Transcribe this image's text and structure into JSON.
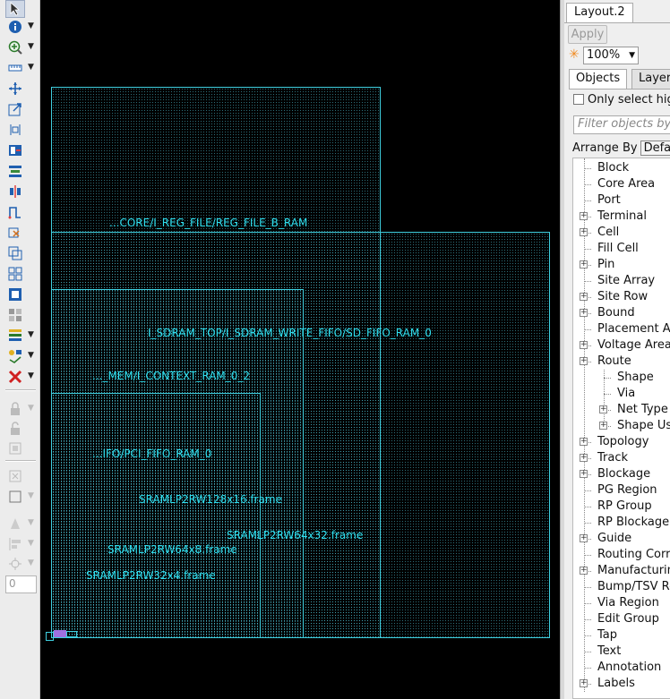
{
  "toolbar": {
    "items": [
      "select-arrow-icon",
      "info-icon",
      "zoom-in-icon",
      "ruler-icon",
      "move-icon",
      "stretch-icon",
      "align-icon",
      "snap-icon",
      "distribute-icon",
      "spacing-icon",
      "flip-icon",
      "route-icon",
      "cut-icon",
      "resize-icon",
      "group-icon",
      "place-icon",
      "grid-icon",
      "highlight-icon",
      "layers-icon",
      "delete-icon",
      "lock-icon",
      "unlock-icon",
      "bbox-icon",
      "box-select-icon",
      "rect-icon",
      "paint-icon",
      "align-left-icon",
      "target-icon"
    ],
    "input_value": "0"
  },
  "canvas": {
    "labels": [
      "...CORE/I_REG_FILE/REG_FILE_B_RAM",
      "I_SDRAM_TOP/I_SDRAM_WRITE_FIFO/SD_FIFO_RAM_0",
      "..._MEM/I_CONTEXT_RAM_0_2",
      "...IFO/PCI_FIFO_RAM_0",
      "SRAMLP2RW128x16.frame",
      "SRAMLP2RW64x32.frame",
      "SRAMLP2RW64x8.frame",
      "SRAMLP2RW32x4.frame"
    ]
  },
  "panel": {
    "title_tab": "Layout.2",
    "apply_label": "Apply",
    "zoom_value": "100%",
    "tabs": [
      "Objects",
      "Layers"
    ],
    "only_select_label": "Only select highlighted",
    "filter_placeholder": "Filter objects by name",
    "arrange_by_label": "Arrange By",
    "arrange_by_value": "Default",
    "tree": [
      {
        "label": "Block",
        "expand": false,
        "level": 0
      },
      {
        "label": "Core Area",
        "expand": false,
        "level": 0
      },
      {
        "label": "Port",
        "expand": false,
        "level": 0
      },
      {
        "label": "Terminal",
        "expand": true,
        "level": 0
      },
      {
        "label": "Cell",
        "expand": true,
        "level": 0
      },
      {
        "label": "Fill Cell",
        "expand": false,
        "level": 0
      },
      {
        "label": "Pin",
        "expand": true,
        "level": 0
      },
      {
        "label": "Site Array",
        "expand": false,
        "level": 0
      },
      {
        "label": "Site Row",
        "expand": true,
        "level": 0
      },
      {
        "label": "Bound",
        "expand": true,
        "level": 0
      },
      {
        "label": "Placement Area",
        "expand": false,
        "level": 0
      },
      {
        "label": "Voltage Area",
        "expand": true,
        "level": 0
      },
      {
        "label": "Route",
        "expand": true,
        "level": 0
      },
      {
        "label": "Shape",
        "expand": false,
        "level": 1
      },
      {
        "label": "Via",
        "expand": false,
        "level": 1
      },
      {
        "label": "Net Type",
        "expand": true,
        "level": 1
      },
      {
        "label": "Shape Use",
        "expand": true,
        "level": 1
      },
      {
        "label": "Topology",
        "expand": true,
        "level": 0
      },
      {
        "label": "Track",
        "expand": true,
        "level": 0
      },
      {
        "label": "Blockage",
        "expand": true,
        "level": 0
      },
      {
        "label": "PG Region",
        "expand": false,
        "level": 0
      },
      {
        "label": "RP Group",
        "expand": false,
        "level": 0
      },
      {
        "label": "RP Blockage",
        "expand": false,
        "level": 0
      },
      {
        "label": "Guide",
        "expand": true,
        "level": 0
      },
      {
        "label": "Routing Corridor",
        "expand": false,
        "level": 0
      },
      {
        "label": "Manufacturing",
        "expand": true,
        "level": 0
      },
      {
        "label": "Bump/TSV Region",
        "expand": false,
        "level": 0
      },
      {
        "label": "Via Region",
        "expand": false,
        "level": 0
      },
      {
        "label": "Edit Group",
        "expand": false,
        "level": 0
      },
      {
        "label": "Tap",
        "expand": false,
        "level": 0
      },
      {
        "label": "Text",
        "expand": false,
        "level": 0
      },
      {
        "label": "Annotation",
        "expand": false,
        "level": 0
      },
      {
        "label": "Labels",
        "expand": true,
        "level": 0
      }
    ]
  }
}
